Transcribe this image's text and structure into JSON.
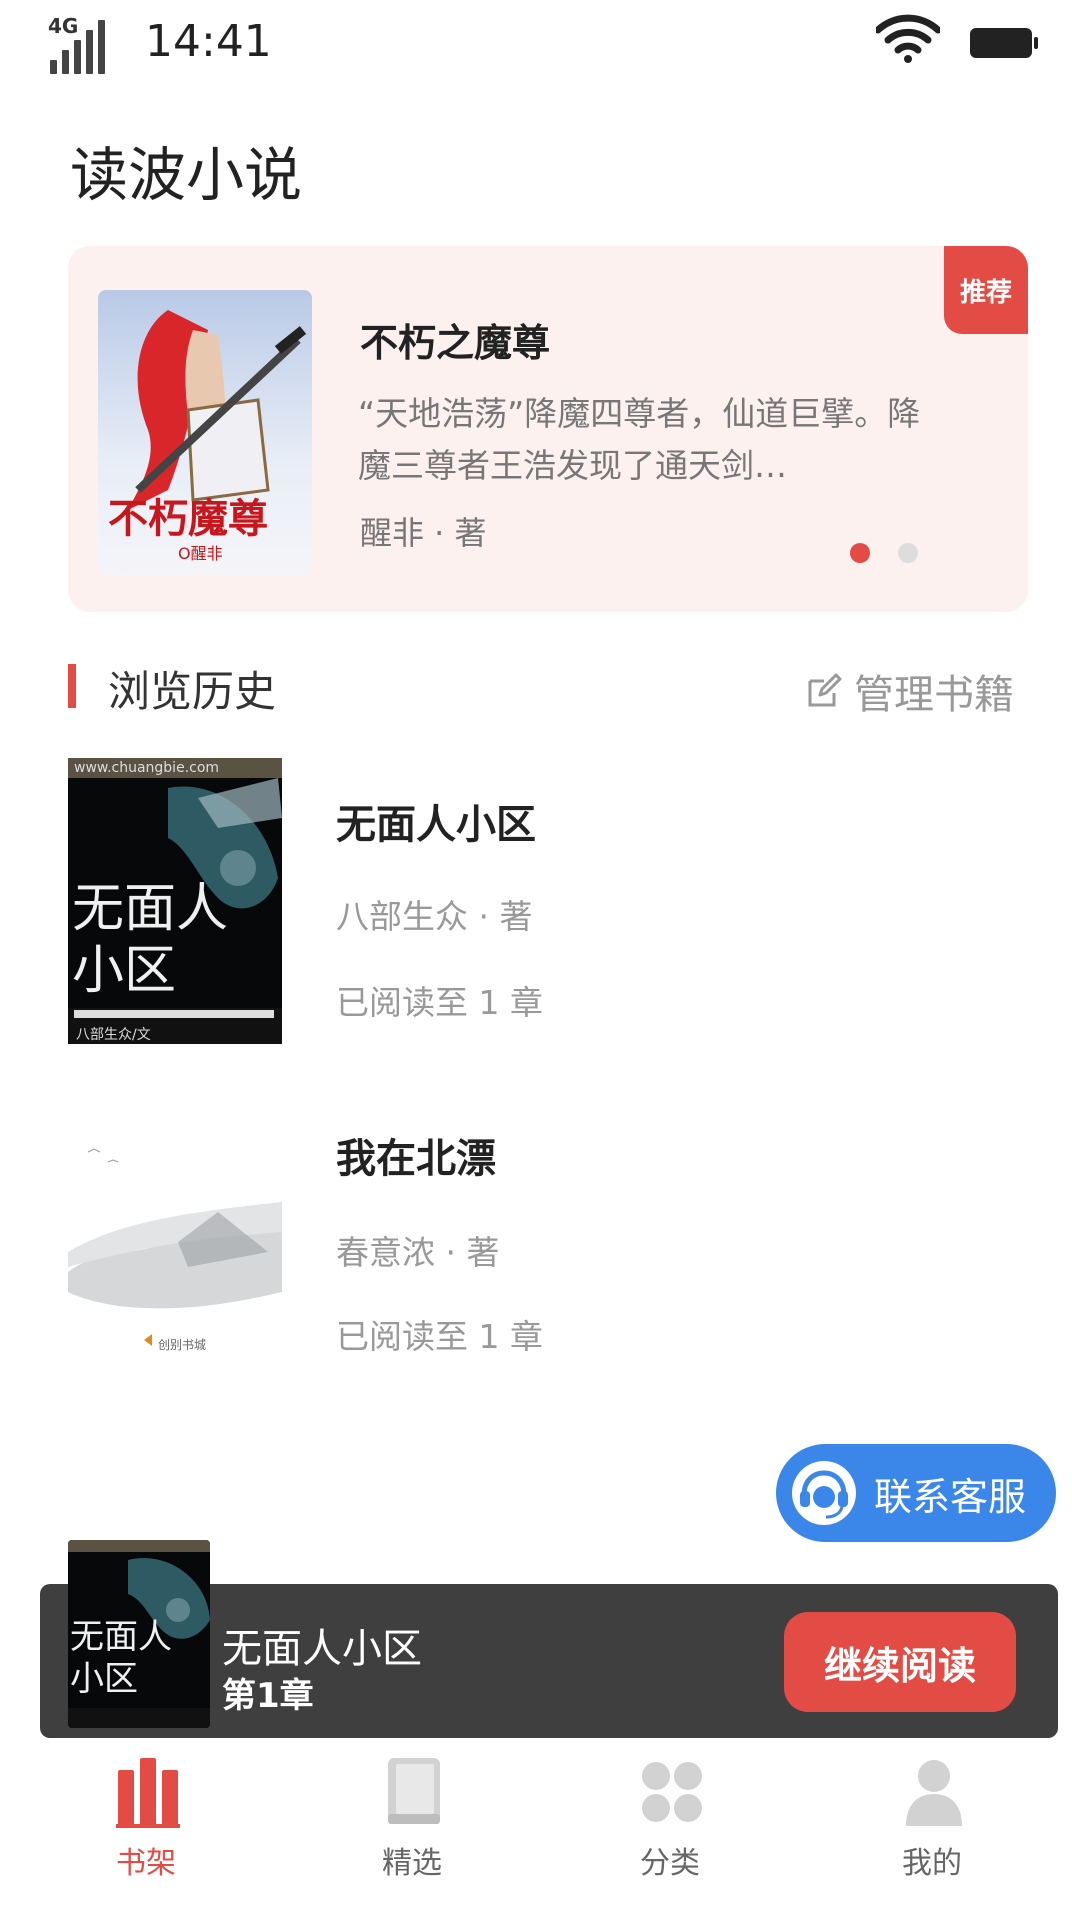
{
  "status": {
    "network": "4G",
    "time": "14:41"
  },
  "app_title": "读波小说",
  "banner": {
    "tag": "推荐",
    "title": "不朽之魔尊",
    "description": "“天地浩荡”降魔四尊者，仙道巨擘。降魔三尊者王浩发现了通天剑…",
    "author": "醒非 · 著",
    "cover_text": "不朽魔尊",
    "cover_sub": "O醒非",
    "active_dot": 1,
    "dot_count": 2
  },
  "history": {
    "title": "浏览历史",
    "manage_label": "管理书籍",
    "books": [
      {
        "title": "无面人小区",
        "author": "八部生众 · 著",
        "progress": "已阅读至 1 章",
        "cover_text": "无面人小区",
        "cover_site": "www.chuangbie.com",
        "cover_author": "八部生众/文"
      },
      {
        "title": "我在北漂",
        "author": "春意浓 · 著",
        "progress": "已阅读至 1 章",
        "cover_badge": "创别书城"
      }
    ]
  },
  "service": {
    "label": "联系客服"
  },
  "continue": {
    "title": "无面人小区",
    "chapter": "第1章",
    "button": "继续阅读"
  },
  "tabs": [
    {
      "label": "书架",
      "icon": "bookshelf-icon",
      "active": true
    },
    {
      "label": "精选",
      "icon": "book-icon",
      "active": false
    },
    {
      "label": "分类",
      "icon": "category-icon",
      "active": false
    },
    {
      "label": "我的",
      "icon": "user-icon",
      "active": false
    }
  ],
  "colors": {
    "accent": "#e34c45",
    "service": "#3b87e9",
    "banner_bg": "#fdf1f0",
    "bar_bg": "#3f3f3f"
  }
}
